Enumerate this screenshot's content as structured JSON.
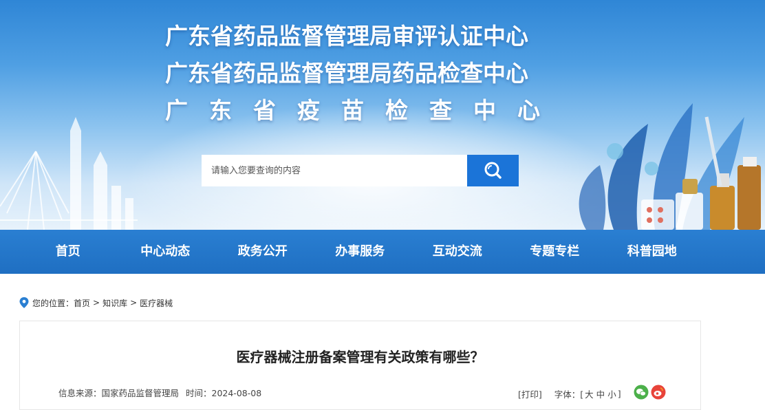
{
  "header": {
    "title_lines": [
      "广东省药品监督管理局审评认证中心",
      "广东省药品监督管理局药品检查中心",
      "广东省疫苗检查中心"
    ]
  },
  "search": {
    "placeholder": "请输入您要查询的内容",
    "icon": "search-icon"
  },
  "nav": {
    "items": [
      "首页",
      "中心动态",
      "政务公开",
      "办事服务",
      "互动交流",
      "专题专栏",
      "科普园地"
    ]
  },
  "breadcrumb": {
    "prefix": "您的位置：",
    "items": [
      "首页",
      "知识库",
      "医疗器械"
    ],
    "separator": ">"
  },
  "article": {
    "title": "医疗器械注册备案管理有关政策有哪些？",
    "source_label": "信息来源：国家药品监督管理局",
    "time_label": "时间：2024-08-08",
    "print_label": "[打印]",
    "font_label": "字体：[",
    "font_sizes": [
      "大",
      "中",
      "小"
    ],
    "font_close": "]",
    "share_icons": [
      "wechat-icon",
      "weibo-icon"
    ]
  },
  "colors": {
    "nav_bg": "#1f6fc2",
    "search_button": "#1b74d8",
    "banner_top": "#2f86d6"
  }
}
